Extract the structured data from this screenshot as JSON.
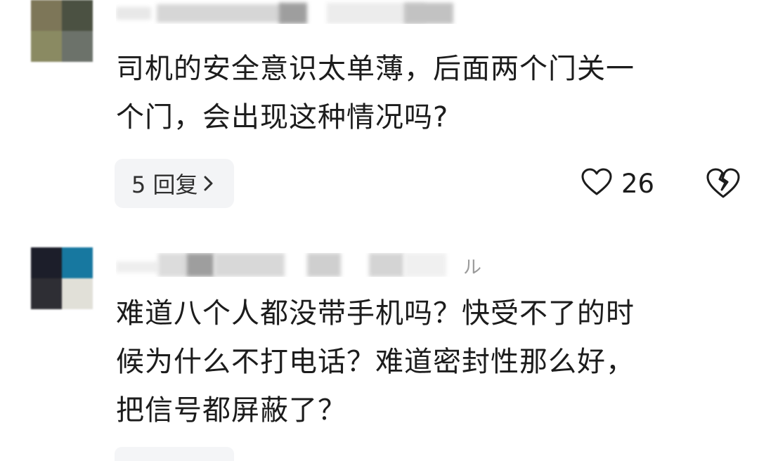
{
  "comments": [
    {
      "lines": [
        "司机的安全意识太单薄，后面两个门关一",
        "个门，会出现这种情况吗?"
      ],
      "replies_label": "5 回复",
      "like_count": "26"
    },
    {
      "username_visible_tail": "ル",
      "lines": [
        "难道八个人都没带手机吗？快受不了的时",
        "候为什么不打电话？难道密封性那么好，",
        "把信号都屏蔽了？"
      ]
    }
  ],
  "icons": {
    "replies_chevron": "chevron-right-icon",
    "like": "heart-outline-icon",
    "dislike": "broken-heart-icon"
  },
  "colors": {
    "background": "#ffffff",
    "text": "#1c1c1c",
    "reply_button_bg": "#f3f4f6",
    "muted": "#9a9a9a"
  }
}
